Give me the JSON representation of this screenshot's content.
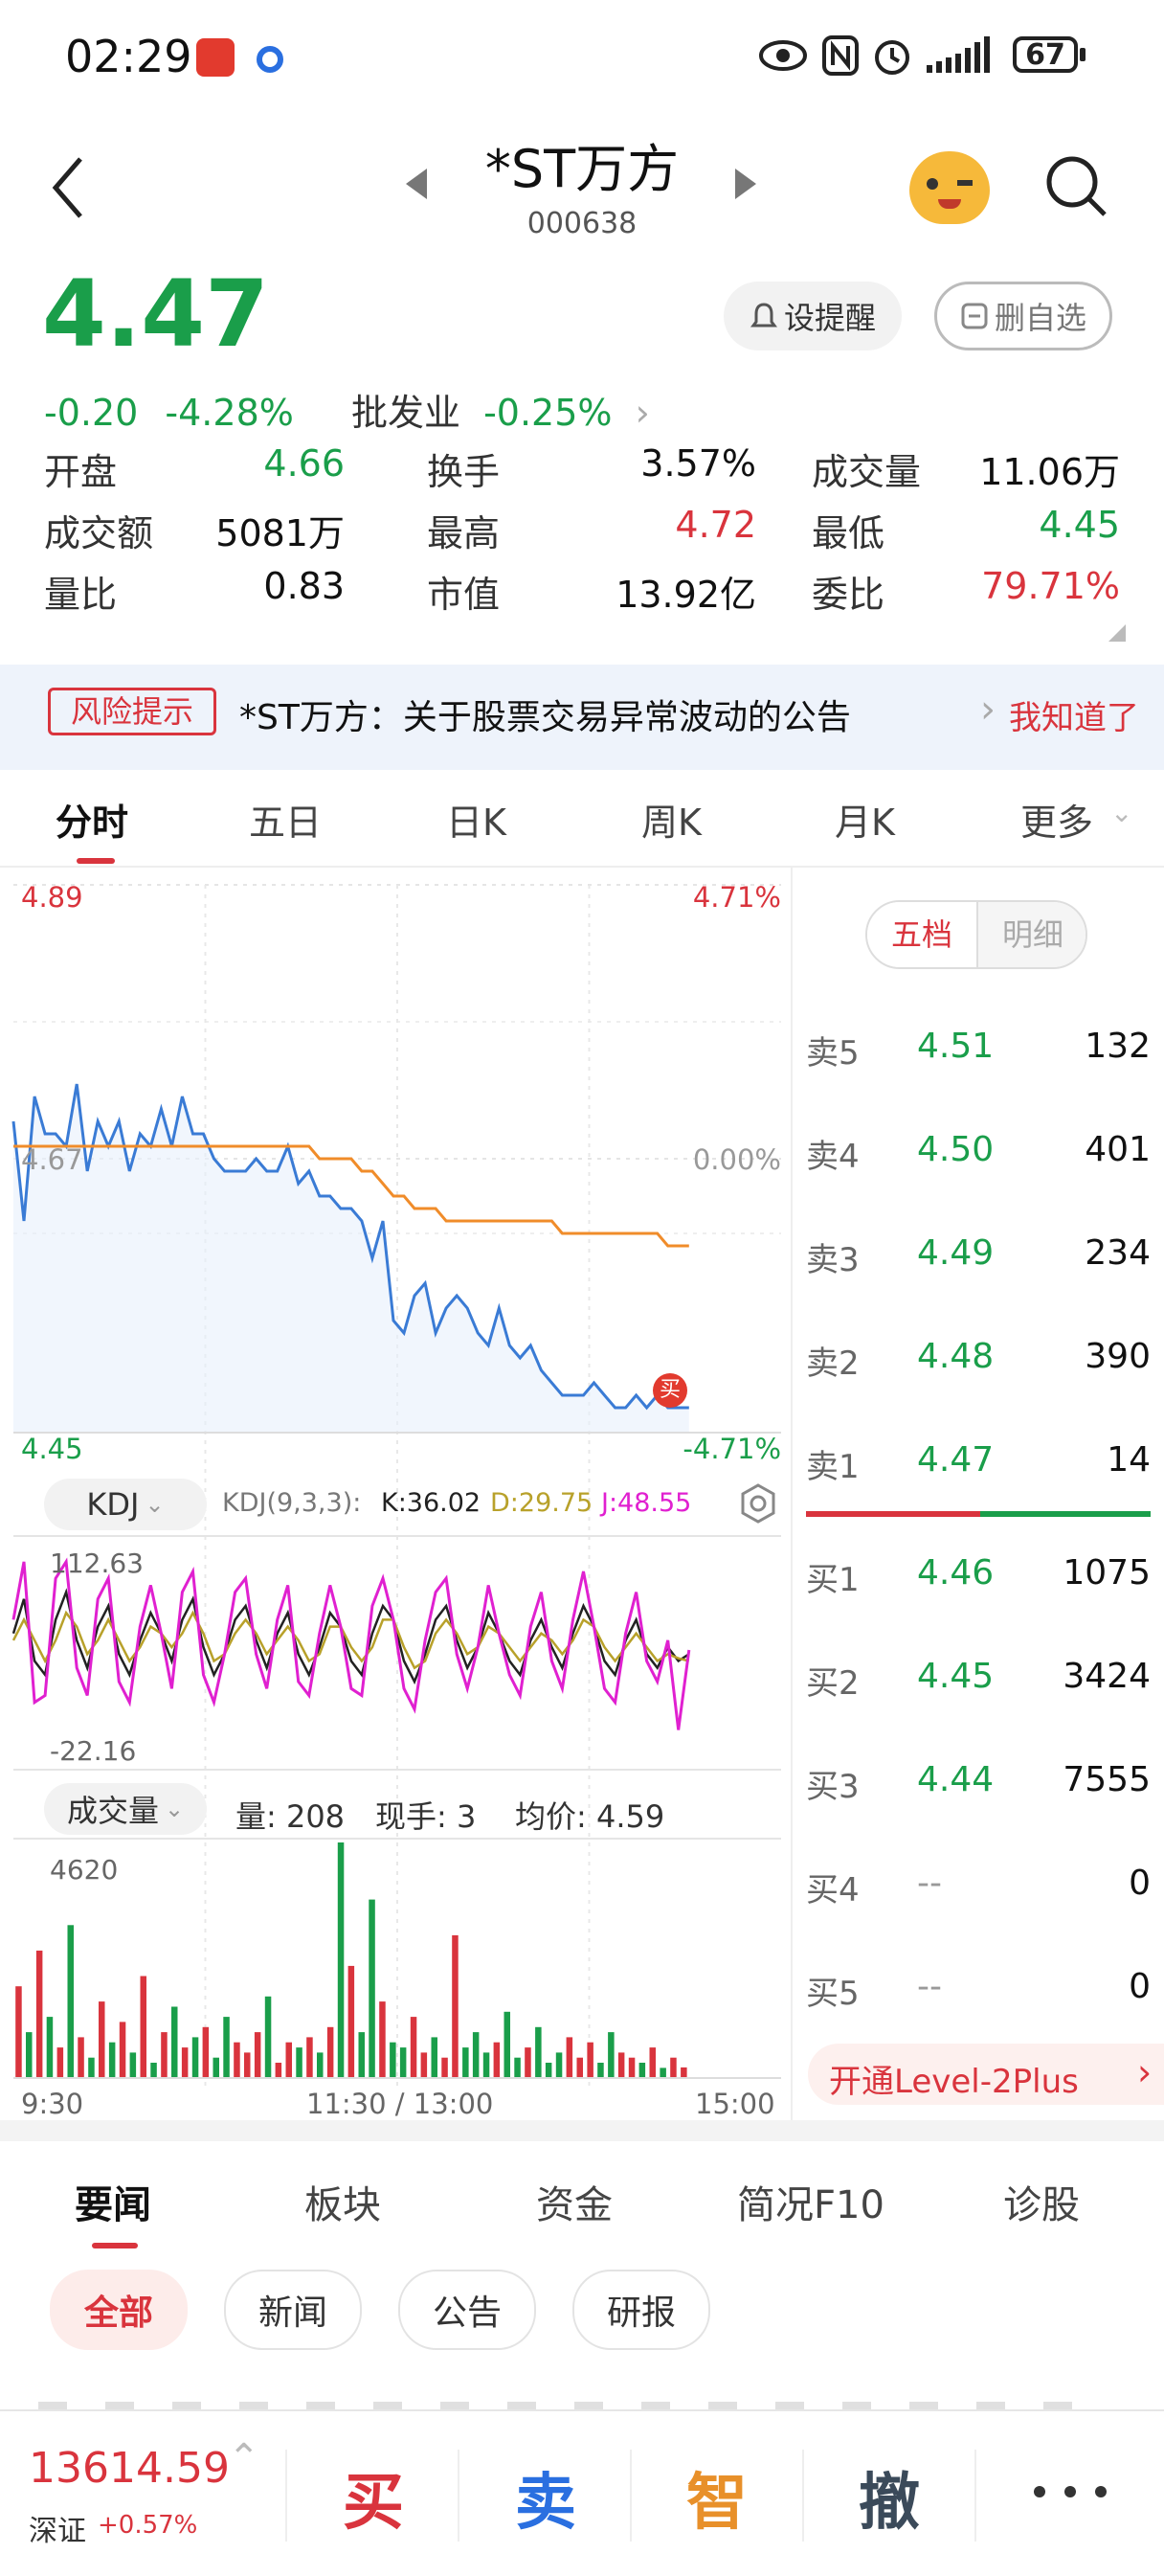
{
  "status_bar": {
    "time": "02:29",
    "battery": "67"
  },
  "header": {
    "title": "*ST万方",
    "code": "000638"
  },
  "quote": {
    "price": "4.47",
    "change": "-0.20",
    "change_pct": "-4.28%",
    "sector": "批发业",
    "sector_pct": "-0.25%",
    "remind_label": "设提醒",
    "unfollow_label": "删自选",
    "stats": [
      {
        "label": "开盘",
        "value": "4.66",
        "color": "#1a9e4a"
      },
      {
        "label": "换手",
        "value": "3.57%",
        "color": "#111111"
      },
      {
        "label": "成交量",
        "value": "11.06万",
        "color": "#111111"
      },
      {
        "label": "成交额",
        "value": "5081万",
        "color": "#111111"
      },
      {
        "label": "最高",
        "value": "4.72",
        "color": "#d9343d"
      },
      {
        "label": "最低",
        "value": "4.45",
        "color": "#1a9e4a"
      },
      {
        "label": "量比",
        "value": "0.83",
        "color": "#111111"
      },
      {
        "label": "市值",
        "value": "13.92亿",
        "color": "#111111"
      },
      {
        "label": "委比",
        "value": "79.71%",
        "color": "#d9343d"
      }
    ]
  },
  "risk_notice": {
    "tag": "风险提示",
    "text": "*ST万方：关于股票交易异常波动的公告",
    "action": "我知道了"
  },
  "chart_tabs": [
    "分时",
    "五日",
    "日K",
    "周K",
    "月K",
    "更多"
  ],
  "intraday": {
    "price_top": "4.89",
    "price_mid": "4.67",
    "price_bottom": "4.45",
    "pct_top": "4.71%",
    "pct_mid": "0.00%",
    "pct_bottom": "-4.71%",
    "buy_marker": "买",
    "kdj": {
      "selector": "KDJ",
      "params": "KDJ(9,3,3):",
      "k": "K:36.02",
      "d": "D:29.75",
      "j": "J:48.55",
      "max": "112.63",
      "min": "-22.16"
    },
    "volume": {
      "selector": "成交量",
      "vol": "量: 208",
      "hand": "现手: 3",
      "avg": "均价: 4.59",
      "max": "4620"
    },
    "time_labels": [
      "9:30",
      "11:30 / 13:00",
      "15:00"
    ]
  },
  "chart_data": {
    "type": "line",
    "x_range": [
      "9:30",
      "15:00"
    ],
    "ylim": [
      4.45,
      4.89
    ],
    "series": [
      {
        "name": "价格",
        "color": "#3a7bd5",
        "values": [
          4.7,
          4.62,
          4.72,
          4.69,
          4.69,
          4.68,
          4.73,
          4.66,
          4.7,
          4.68,
          4.7,
          4.66,
          4.69,
          4.68,
          4.71,
          4.68,
          4.72,
          4.69,
          4.69,
          4.67,
          4.66,
          4.66,
          4.66,
          4.67,
          4.66,
          4.66,
          4.68,
          4.65,
          4.66,
          4.64,
          4.64,
          4.63,
          4.63,
          4.62,
          4.59,
          4.62,
          4.54,
          4.53,
          4.56,
          4.57,
          4.53,
          4.55,
          4.56,
          4.55,
          4.53,
          4.52,
          4.55,
          4.52,
          4.51,
          4.52,
          4.5,
          4.49,
          4.48,
          4.48,
          4.48,
          4.49,
          4.48,
          4.47,
          4.47,
          4.48,
          4.47,
          4.48,
          4.47,
          4.47,
          4.47
        ]
      },
      {
        "name": "均价",
        "color": "#f08c2a",
        "values": [
          4.68,
          4.68,
          4.68,
          4.68,
          4.68,
          4.68,
          4.68,
          4.68,
          4.68,
          4.68,
          4.68,
          4.68,
          4.68,
          4.68,
          4.68,
          4.68,
          4.68,
          4.68,
          4.68,
          4.68,
          4.68,
          4.68,
          4.68,
          4.68,
          4.68,
          4.68,
          4.68,
          4.68,
          4.68,
          4.67,
          4.67,
          4.67,
          4.67,
          4.66,
          4.66,
          4.65,
          4.64,
          4.64,
          4.63,
          4.63,
          4.63,
          4.62,
          4.62,
          4.62,
          4.62,
          4.62,
          4.62,
          4.62,
          4.62,
          4.62,
          4.62,
          4.62,
          4.61,
          4.61,
          4.61,
          4.61,
          4.61,
          4.61,
          4.61,
          4.61,
          4.61,
          4.61,
          4.6,
          4.6,
          4.6
        ]
      }
    ],
    "kdj_series": [
      {
        "name": "K",
        "color": "#222222",
        "values": [
          60,
          85,
          40,
          30,
          70,
          90,
          55,
          35,
          65,
          80,
          45,
          30,
          55,
          75,
          60,
          40,
          70,
          85,
          50,
          30,
          45,
          70,
          80,
          55,
          35,
          60,
          75,
          45,
          30,
          50,
          75,
          65,
          40,
          30,
          60,
          80,
          70,
          40,
          25,
          45,
          70,
          80,
          55,
          35,
          50,
          75,
          60,
          40,
          30,
          55,
          70,
          50,
          35,
          60,
          80,
          65,
          40,
          30,
          55,
          70,
          45,
          35,
          50,
          40,
          45
        ]
      },
      {
        "name": "D",
        "color": "#b8a12a",
        "values": [
          55,
          70,
          55,
          40,
          55,
          75,
          65,
          45,
          55,
          70,
          55,
          40,
          50,
          65,
          60,
          50,
          60,
          75,
          60,
          40,
          45,
          60,
          70,
          60,
          45,
          55,
          65,
          55,
          40,
          45,
          65,
          65,
          50,
          40,
          50,
          70,
          70,
          50,
          35,
          40,
          60,
          70,
          60,
          45,
          50,
          65,
          60,
          50,
          40,
          50,
          60,
          55,
          45,
          55,
          70,
          65,
          50,
          40,
          50,
          60,
          50,
          40,
          45,
          42,
          40
        ]
      },
      {
        "name": "J",
        "color": "#e020d0",
        "values": [
          70,
          112,
          10,
          15,
          100,
          112,
          35,
          15,
          85,
          100,
          25,
          10,
          65,
          95,
          60,
          20,
          90,
          105,
          30,
          10,
          45,
          90,
          100,
          45,
          20,
          70,
          95,
          25,
          15,
          60,
          95,
          65,
          20,
          15,
          80,
          100,
          70,
          20,
          5,
          55,
          90,
          100,
          45,
          20,
          50,
          95,
          60,
          30,
          15,
          65,
          90,
          40,
          20,
          70,
          105,
          65,
          20,
          10,
          60,
          90,
          40,
          25,
          55,
          -10,
          48
        ]
      }
    ],
    "volume_values": [
      1800,
      900,
      2500,
      1200,
      600,
      3000,
      800,
      400,
      1500,
      700,
      1100,
      500,
      2000,
      300,
      900,
      1400,
      600,
      800,
      1000,
      400,
      1200,
      700,
      500,
      900,
      1600,
      300,
      700,
      600,
      800,
      500,
      1000,
      4620,
      2200,
      900,
      3500,
      1500,
      700,
      600,
      1200,
      500,
      800,
      400,
      2800,
      600,
      900,
      500,
      700,
      1300,
      400,
      600,
      1000,
      300,
      500,
      800,
      400,
      700,
      300,
      900,
      500,
      400,
      300,
      600,
      200,
      400,
      208
    ]
  },
  "order_book": {
    "tabs": [
      "五档",
      "明细"
    ],
    "asks": [
      {
        "label": "卖5",
        "price": "4.51",
        "vol": "132"
      },
      {
        "label": "卖4",
        "price": "4.50",
        "vol": "401"
      },
      {
        "label": "卖3",
        "price": "4.49",
        "vol": "234"
      },
      {
        "label": "卖2",
        "price": "4.48",
        "vol": "390"
      },
      {
        "label": "卖1",
        "price": "4.47",
        "vol": "14"
      }
    ],
    "bids": [
      {
        "label": "买1",
        "price": "4.46",
        "vol": "1075"
      },
      {
        "label": "买2",
        "price": "4.45",
        "vol": "3424"
      },
      {
        "label": "买3",
        "price": "4.44",
        "vol": "7555"
      },
      {
        "label": "买4",
        "price": "--",
        "vol": "0"
      },
      {
        "label": "买5",
        "price": "--",
        "vol": "0"
      }
    ],
    "level2": "开通Level-2Plus"
  },
  "news_tabs": [
    "要闻",
    "板块",
    "资金",
    "简况F10",
    "诊股"
  ],
  "news_filters": [
    "全部",
    "新闻",
    "公告",
    "研报"
  ],
  "bottom_bar": {
    "index_value": "13614.59",
    "index_name": "深证",
    "index_pct": "+0.57%",
    "buy": "买",
    "sell": "卖",
    "smart": "智",
    "cancel": "撤"
  }
}
